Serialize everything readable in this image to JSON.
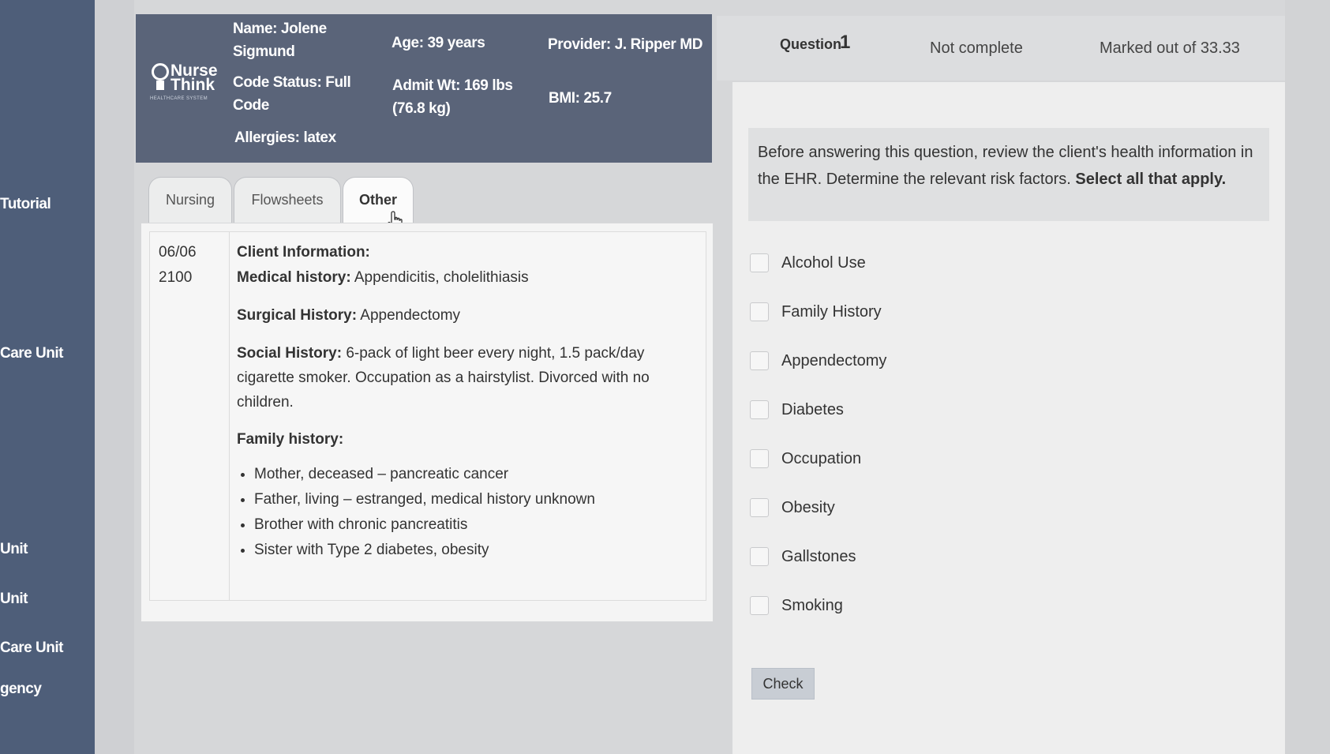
{
  "sidebar": {
    "items": [
      {
        "label": "Tutorial"
      },
      {
        "label": "Care Unit"
      },
      {
        "label": "Unit"
      },
      {
        "label": "Unit"
      },
      {
        "label": "Care Unit"
      },
      {
        "label": "gency"
      }
    ]
  },
  "ehr": {
    "logo": {
      "line1": "Nurse",
      "line2": "Think",
      "tagline": "HEALTHCARE SYSTEM"
    },
    "name_l1": "Name: Jolene",
    "name_l2": "Sigmund",
    "code_l1": "Code Status: Full",
    "code_l2": "Code",
    "allergies": "Allergies: latex",
    "age": "Age: 39 years",
    "admit_l1": "Admit Wt: 169 lbs",
    "admit_l2": "(76.8 kg)",
    "provider": "Provider: J. Ripper MD",
    "bmi": "BMI: 25.7"
  },
  "tabs": [
    {
      "label": "Nursing"
    },
    {
      "label": "Flowsheets"
    },
    {
      "label": "Other"
    }
  ],
  "record": {
    "date": "06/06",
    "time": "2100",
    "client_info_heading": "Client Information:",
    "medical_label": "Medical history:",
    "medical_value": " Appendicitis, cholelithiasis",
    "surgical_label": "Surgical History:",
    "surgical_value": " Appendectomy",
    "social_label": "Social History:",
    "social_value": " 6-pack of light beer every night, 1.5 pack/day cigarette smoker. Occupation as a hairstylist. Divorced with no children.",
    "family_label": "Family history:",
    "family_items": [
      "Mother, deceased – pancreatic cancer",
      "Father, living – estranged, medical history unknown",
      "Brother with chronic pancreatitis",
      "Sister with Type 2 diabetes, obesity"
    ]
  },
  "quiz": {
    "question_label": "Question",
    "question_number": "1",
    "status": "Not complete",
    "marks": "Marked out of 33.33",
    "prompt_plain": "Before answering this question, review the client's health information in the EHR.  Determine the relevant risk factors.",
    "prompt_bold": " Select all that apply.",
    "options": [
      {
        "label": "Alcohol Use"
      },
      {
        "label": "Family History"
      },
      {
        "label": "Appendectomy"
      },
      {
        "label": "Diabetes"
      },
      {
        "label": "Occupation"
      },
      {
        "label": "Obesity"
      },
      {
        "label": "Gallstones"
      },
      {
        "label": "Smoking"
      }
    ],
    "check_label": "Check"
  }
}
